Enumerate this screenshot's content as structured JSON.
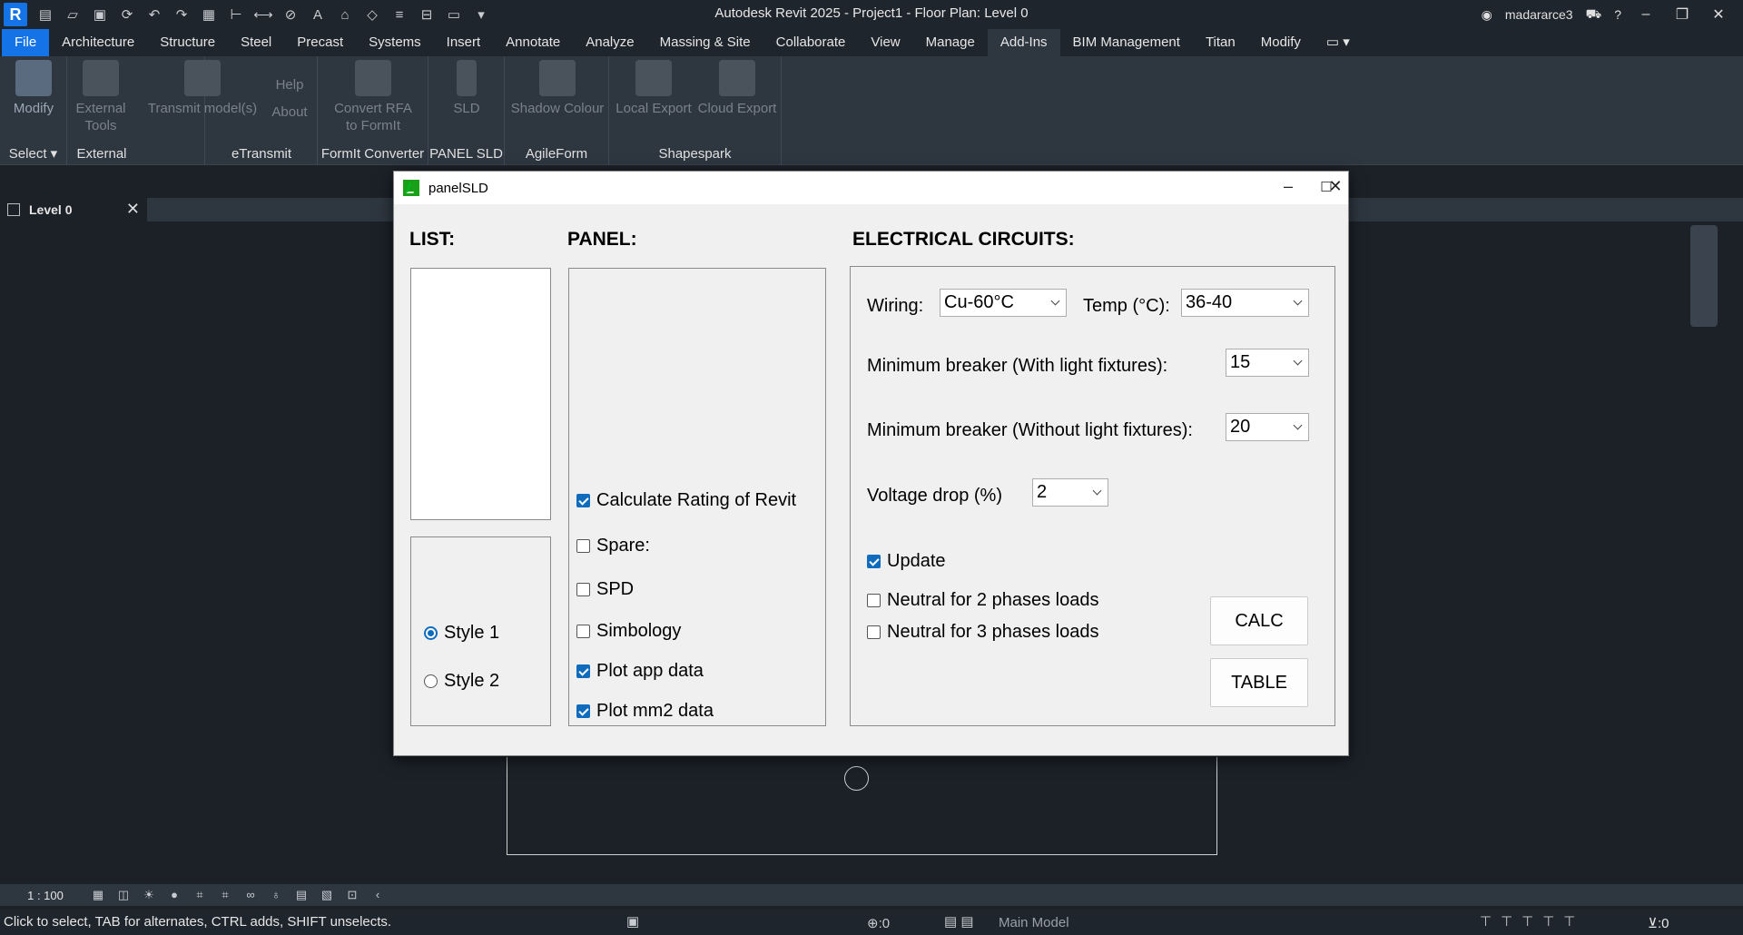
{
  "app": {
    "logo_letter": "R",
    "window_title": "Autodesk Revit 2025 - Project1 - Floor Plan: Level 0",
    "username": "madararce3"
  },
  "ribbon_tabs": [
    "File",
    "Architecture",
    "Structure",
    "Steel",
    "Precast",
    "Systems",
    "Insert",
    "Annotate",
    "Analyze",
    "Massing & Site",
    "Collaborate",
    "View",
    "Manage",
    "Add-Ins",
    "BIM Management",
    "Titan",
    "Modify"
  ],
  "active_tab": "Add-Ins",
  "ribbon": {
    "buttons": {
      "modify": "Modify",
      "external_tools_1": "External",
      "external_tools_2": "Tools",
      "transmit": "Transmit model(s)",
      "help": "Help",
      "about": "About",
      "convert_1": "Convert RFA",
      "convert_2": "to FormIt",
      "sld": "SLD",
      "shadow_colour": "Shadow Colour",
      "local_export": "Local Export",
      "cloud_export": "Cloud Export"
    },
    "groups": {
      "select": "Select",
      "external": "External",
      "etransmit": "eTransmit",
      "formit": "FormIt Converter",
      "panel_sld": "PANEL SLD",
      "agileform": "AgileForm",
      "shapespark": "Shapespark"
    }
  },
  "view_tab": {
    "label": "Level 0"
  },
  "view_bar": {
    "scale": "1 : 100"
  },
  "status_bar": {
    "message": "Click to select, TAB for alternates, CTRL adds, SHIFT unselects.",
    "model": "Main Model",
    "selection_count": ":0",
    "filter_count": ":0"
  },
  "dialog": {
    "title": "panelSLD",
    "list_heading": "LIST:",
    "panel_heading": "PANEL:",
    "circuits_heading": "ELECTRICAL CIRCUITS:",
    "styles": [
      {
        "label": "Style 1",
        "selected": true
      },
      {
        "label": "Style 2",
        "selected": false
      }
    ],
    "panel_options": [
      {
        "label": "Calculate Rating of Revit",
        "checked": true
      },
      {
        "label": "Spare:",
        "checked": false
      },
      {
        "label": "SPD",
        "checked": false
      },
      {
        "label": "Simbology",
        "checked": false
      },
      {
        "label": "Plot app data",
        "checked": true
      },
      {
        "label": "Plot mm2 data",
        "checked": true
      }
    ],
    "wiring_label": "Wiring:",
    "wiring_value": "Cu-60°C",
    "temp_label": "Temp (°C):",
    "temp_value": "36-40",
    "min_breaker_with_label": "Minimum breaker (With light fixtures):",
    "min_breaker_with_value": "15",
    "min_breaker_without_label": "Minimum breaker (Without light fixtures):",
    "min_breaker_without_value": "20",
    "voltage_drop_label": "Voltage drop (%)",
    "voltage_drop_value": "2",
    "update": {
      "label": "Update",
      "checked": true
    },
    "neutral_2": {
      "label": "Neutral for 2 phases loads",
      "checked": false
    },
    "neutral_3": {
      "label": "Neutral for 3 phases loads",
      "checked": false
    },
    "calc_button": "CALC",
    "table_button": "TABLE"
  }
}
